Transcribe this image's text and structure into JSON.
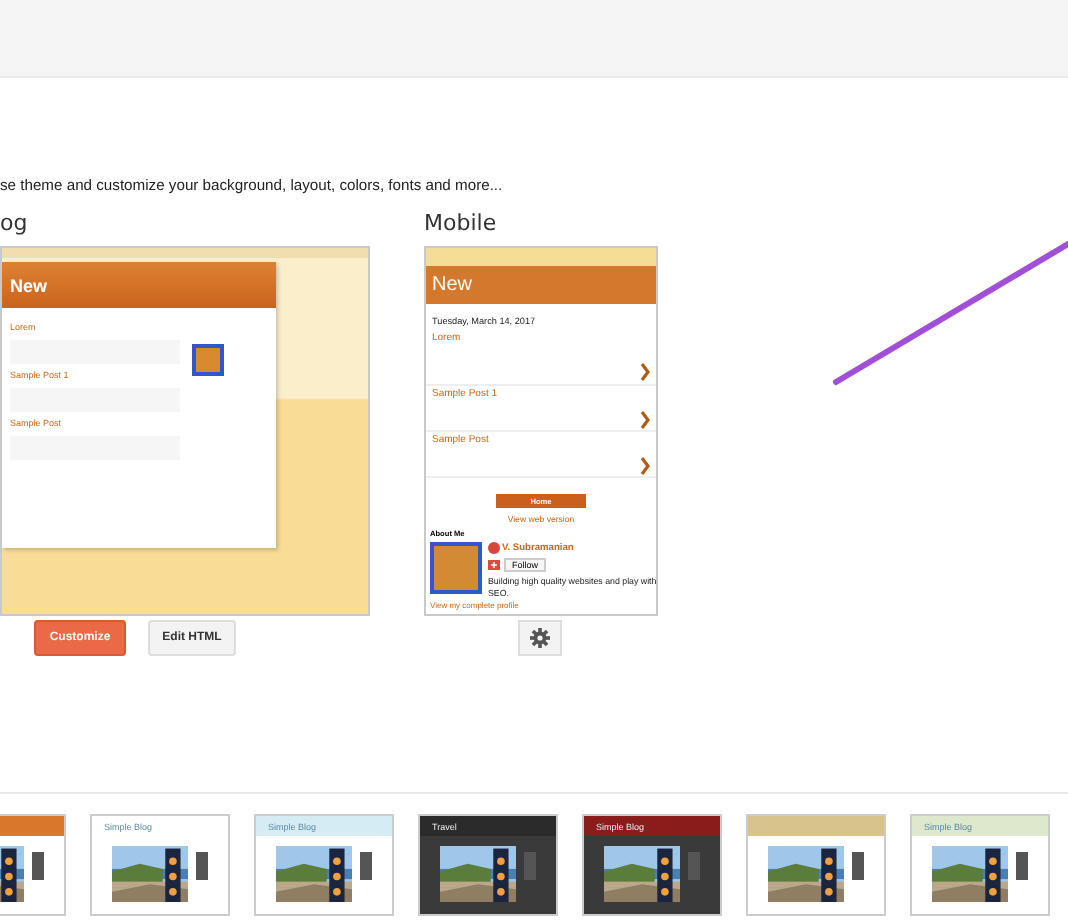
{
  "intro": "se theme and customize your background, layout, colors, fonts and more...",
  "blog": {
    "heading": "og",
    "preview": {
      "title": "New",
      "posts": [
        "Lorem",
        "Sample Post 1",
        "Sample Post"
      ]
    },
    "buttons": [
      {
        "label": "Customize",
        "kind": "primary"
      },
      {
        "label": "Edit HTML",
        "kind": "secondary"
      }
    ]
  },
  "mobile": {
    "heading": "Mobile",
    "preview": {
      "title": "New",
      "date": "Tuesday, March 14, 2017",
      "posts": [
        "Lorem",
        "Sample Post 1",
        "Sample Post"
      ],
      "home": "Home",
      "web_link": "View web version",
      "about_heading": "About Me",
      "author": "V. Subramanian",
      "follow": "Follow",
      "bio": "Building high quality websites and play with SEO.",
      "profile_link": "View my complete profile"
    }
  },
  "themes": [
    {
      "color": "#d9782c",
      "dark": false
    },
    {
      "color": "#ffffff",
      "title": "Simple Blog",
      "dark": false
    },
    {
      "color": "#d6ecf4",
      "title": "Simple Blog",
      "dark": false
    },
    {
      "color": "#2b2b2b",
      "title": "Travel",
      "dark": true
    },
    {
      "color": "#8b1c1c",
      "title": "Simple Blog",
      "dark": true
    },
    {
      "color": "#d8c48a",
      "dark": false
    },
    {
      "color": "#dde8cc",
      "title": "Simple Blog",
      "dark": false
    }
  ]
}
